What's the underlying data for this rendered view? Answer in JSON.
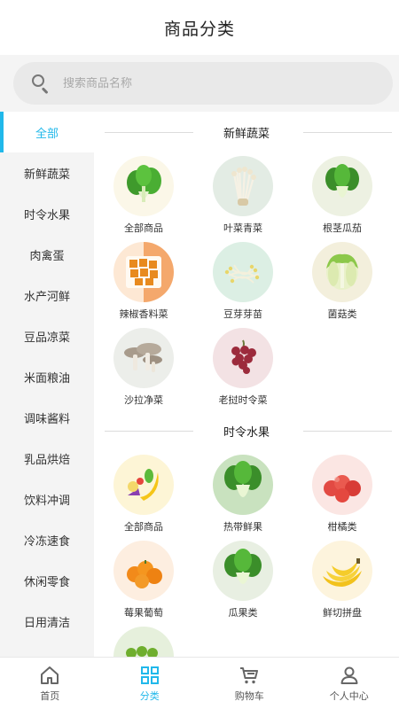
{
  "header": {
    "title": "商品分类"
  },
  "search": {
    "placeholder": "搜索商品名称",
    "icon": "search-icon"
  },
  "sidebar": {
    "items": [
      {
        "label": "全部",
        "active": true
      },
      {
        "label": "新鲜蔬菜"
      },
      {
        "label": "时令水果"
      },
      {
        "label": "肉禽蛋"
      },
      {
        "label": "水产河鲜"
      },
      {
        "label": "豆品凉菜"
      },
      {
        "label": "米面粮油"
      },
      {
        "label": "调味酱料"
      },
      {
        "label": "乳品烘焙"
      },
      {
        "label": "饮料冲调"
      },
      {
        "label": "冷冻速食"
      },
      {
        "label": "休闲零食"
      },
      {
        "label": "日用清洁"
      }
    ]
  },
  "sections": [
    {
      "title": "新鲜蔬菜",
      "items": [
        {
          "label": "全部商品",
          "image": "bok-choy-image"
        },
        {
          "label": "叶菜青菜",
          "image": "enoki-mushroom-image"
        },
        {
          "label": "根茎瓜茄",
          "image": "bok-choy-image"
        },
        {
          "label": "辣椒香料菜",
          "image": "tofu-cubes-image"
        },
        {
          "label": "豆芽芽苗",
          "image": "bean-sprouts-image"
        },
        {
          "label": "菌菇类",
          "image": "napa-cabbage-image"
        },
        {
          "label": "沙拉净菜",
          "image": "oyster-mushroom-image"
        },
        {
          "label": "老挝时令菜",
          "image": "grapes-image"
        }
      ]
    },
    {
      "title": "时令水果",
      "items": [
        {
          "label": "全部商品",
          "image": "fruit-mix-image"
        },
        {
          "label": "热带鲜果",
          "image": "bok-choy-image"
        },
        {
          "label": "柑橘类",
          "image": "apples-image"
        },
        {
          "label": "莓果葡萄",
          "image": "oranges-image"
        },
        {
          "label": "瓜果类",
          "image": "bok-choy-image"
        },
        {
          "label": "鲜切拼盘",
          "image": "bananas-image"
        },
        {
          "label": "",
          "image": "green-grapes-image"
        }
      ]
    }
  ],
  "tabbar": {
    "items": [
      {
        "label": "首页",
        "icon": "home-icon"
      },
      {
        "label": "分类",
        "icon": "category-grid-icon",
        "active": true
      },
      {
        "label": "购物车",
        "icon": "cart-icon"
      },
      {
        "label": "个人中心",
        "icon": "user-icon"
      }
    ]
  },
  "colors": {
    "accent": "#21b8ea",
    "sidebar_bg": "#f4f4f4",
    "search_bg": "#e9e9e9"
  }
}
